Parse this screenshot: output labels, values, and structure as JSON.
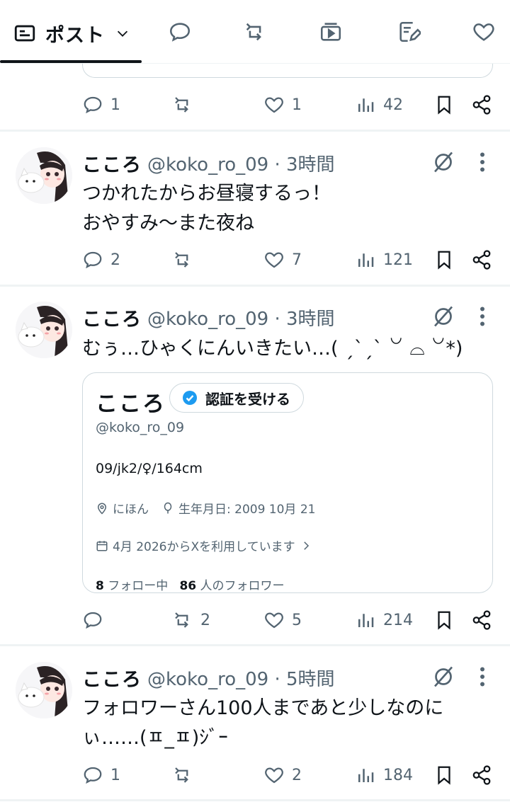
{
  "tabs": {
    "posts_label": "ポスト"
  },
  "tweets": [
    {
      "stats": {
        "replies": "1",
        "reposts": "",
        "likes": "1",
        "views": "42"
      }
    },
    {
      "name": "こころ",
      "handle": "@koko_ro_09 · 3時間",
      "text_lines": [
        "つかれたからお昼寝するっ！",
        "おやすみ〜また夜ね"
      ],
      "stats": {
        "replies": "2",
        "reposts": "",
        "likes": "7",
        "views": "121"
      }
    },
    {
      "name": "こころ",
      "handle": "@koko_ro_09 · 3時間",
      "text_lines": [
        "むぅ…ひゃくにんいきたい…( ˏˋˏˋ ꒡ ⌓ ꒡*)"
      ],
      "stats": {
        "replies": "",
        "reposts": "2",
        "likes": "5",
        "views": "214"
      }
    },
    {
      "name": "こころ",
      "handle": "@koko_ro_09 · 5時間",
      "text_lines": [
        "フォロワーさん100人まであと少しなのに",
        "ぃ……(ㅍ_ㅍ)ｼﾞｰ"
      ],
      "stats": {
        "replies": "1",
        "reposts": "",
        "likes": "2",
        "views": "184"
      }
    }
  ],
  "profile_card": {
    "name": "こころ",
    "verify_label": "認証を受ける",
    "handle": "@koko_ro_09",
    "bio": "09/jk2/♀/164cm",
    "location": "にほん",
    "birthday": "生年月日: 2009 10月 21",
    "joined": "4月 2026からXを利用しています",
    "following_count": "8",
    "following_label": "フォロー中",
    "followers_count": "86",
    "followers_label": "人のフォロワー"
  },
  "colors": {
    "text": "#0f1419",
    "secondary": "#536471",
    "border": "#cfd9de",
    "verified_blue": "#1d9bf0"
  }
}
